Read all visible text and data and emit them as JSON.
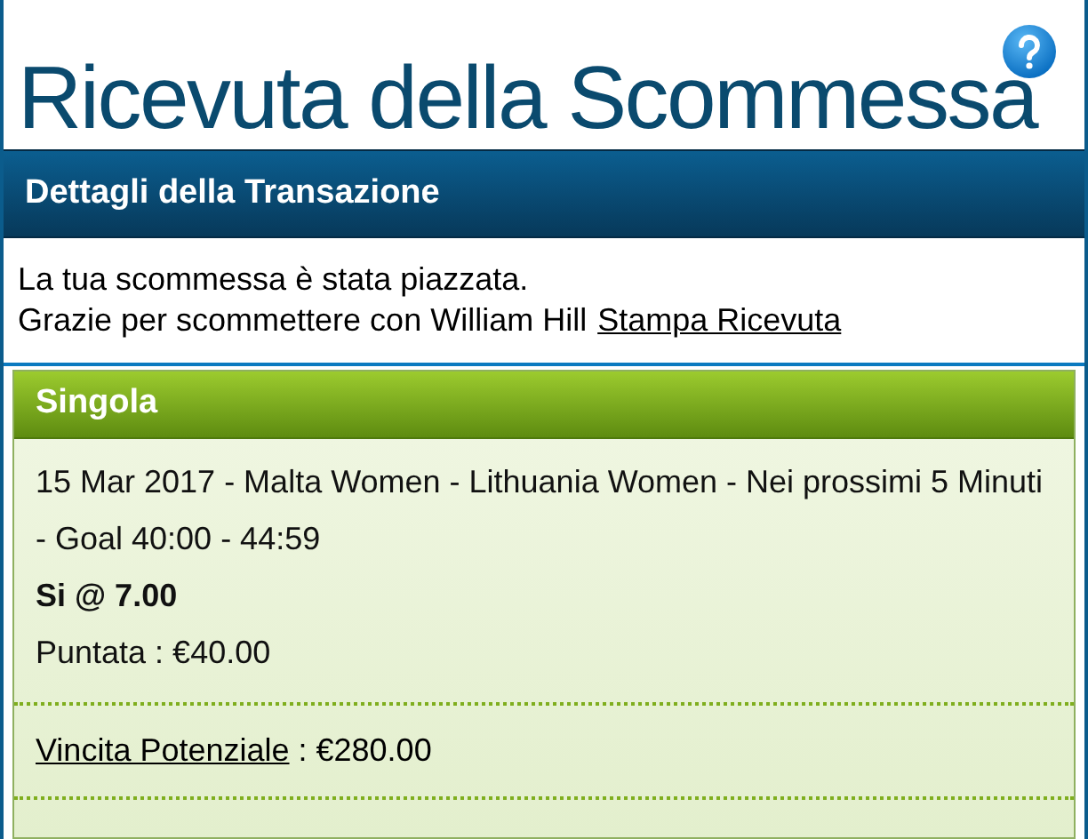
{
  "title": "Ricevuta della Scommessa",
  "section": {
    "title": "Dettagli della Transazione"
  },
  "messages": {
    "line_1": "La tua scommessa è stata piazzata.",
    "line_2": "Grazie per scommettere con William Hill",
    "print_link": "Stampa Ricevuta"
  },
  "bet": {
    "type": "Singola",
    "event": "15 Mar 2017 - Malta Women - Lithuania Women - Nei prossimi 5 Minuti - Goal 40:00 - 44:59",
    "selection": "Si @ 7.00",
    "stake": "Puntata : €40.00",
    "potential_win_link": "Vincita Potenziale",
    "potential_win_value": ": €280.00"
  }
}
